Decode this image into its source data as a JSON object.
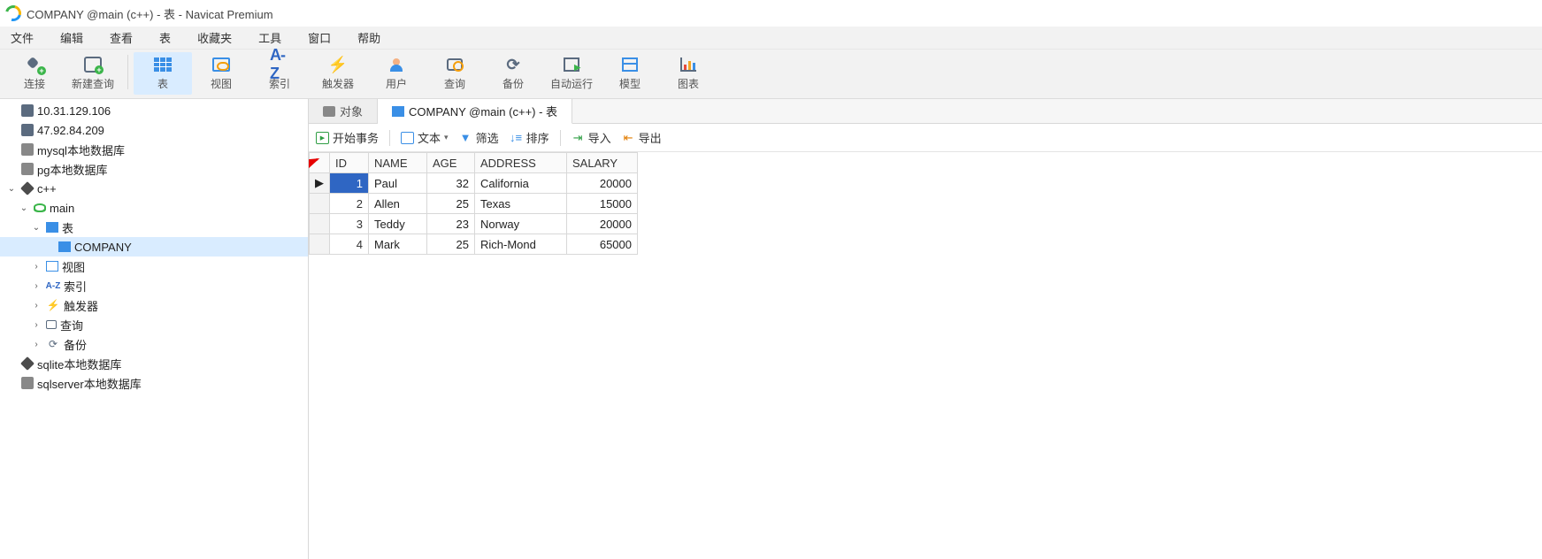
{
  "window": {
    "title": "COMPANY @main (c++) - 表 - Navicat Premium"
  },
  "menu": {
    "file": "文件",
    "edit": "编辑",
    "view": "查看",
    "table": "表",
    "fav": "收藏夹",
    "tools": "工具",
    "window": "窗口",
    "help": "帮助"
  },
  "ribbon": {
    "connect": "连接",
    "newquery": "新建查询",
    "table": "表",
    "view": "视图",
    "index": "索引",
    "index_text": "A-Z",
    "trigger": "触发器",
    "user": "用户",
    "query": "查询",
    "backup": "备份",
    "autorun": "自动运行",
    "model": "模型",
    "chart": "图表"
  },
  "sidebar": {
    "items": [
      {
        "label": "10.31.129.106",
        "icon": "host",
        "depth": 1,
        "tw": ""
      },
      {
        "label": "47.92.84.209",
        "icon": "host",
        "depth": 1,
        "tw": ""
      },
      {
        "label": "mysql本地数据库",
        "icon": "host-grey",
        "depth": 1,
        "tw": ""
      },
      {
        "label": "pg本地数据库",
        "icon": "host-grey",
        "depth": 1,
        "tw": ""
      },
      {
        "label": "c++",
        "icon": "sqlite",
        "depth": 1,
        "tw": "∨"
      },
      {
        "label": "main",
        "icon": "db-green",
        "depth": 2,
        "tw": "∨"
      },
      {
        "label": "表",
        "icon": "table",
        "depth": 3,
        "tw": "∨"
      },
      {
        "label": "COMPANY",
        "icon": "table",
        "depth": 4,
        "tw": "",
        "sel": true
      },
      {
        "label": "视图",
        "icon": "view",
        "depth": 3,
        "tw": ">"
      },
      {
        "label": "索引",
        "icon": "az",
        "depth": 3,
        "tw": ">"
      },
      {
        "label": "触发器",
        "icon": "trig",
        "depth": 3,
        "tw": ">"
      },
      {
        "label": "查询",
        "icon": "query",
        "depth": 3,
        "tw": ">"
      },
      {
        "label": "备份",
        "icon": "backup",
        "depth": 3,
        "tw": ">"
      },
      {
        "label": "sqlite本地数据库",
        "icon": "sqlite",
        "depth": 1,
        "tw": ""
      },
      {
        "label": "sqlserver本地数据库",
        "icon": "host-grey",
        "depth": 1,
        "tw": ""
      }
    ]
  },
  "tabs": {
    "objects": "对象",
    "table": "COMPANY @main (c++) - 表"
  },
  "toolbar": {
    "begin": "开始事务",
    "text": "文本",
    "filter": "筛选",
    "sort": "排序",
    "import": "导入",
    "export": "导出"
  },
  "grid": {
    "columns": [
      "ID",
      "NAME",
      "AGE",
      "ADDRESS",
      "SALARY"
    ],
    "rows": [
      {
        "ID": "1",
        "NAME": "Paul",
        "AGE": "32",
        "ADDRESS": "California",
        "SALARY": "20000",
        "ptr": "▶",
        "sel": true
      },
      {
        "ID": "2",
        "NAME": "Allen",
        "AGE": "25",
        "ADDRESS": "Texas",
        "SALARY": "15000",
        "ptr": ""
      },
      {
        "ID": "3",
        "NAME": "Teddy",
        "AGE": "23",
        "ADDRESS": "Norway",
        "SALARY": "20000",
        "ptr": ""
      },
      {
        "ID": "4",
        "NAME": "Mark",
        "AGE": "25",
        "ADDRESS": "Rich-Mond",
        "SALARY": "65000",
        "ptr": ""
      }
    ],
    "colwidths": {
      "ID": 44,
      "NAME": 66,
      "AGE": 54,
      "ADDRESS": 104,
      "SALARY": 80
    }
  }
}
